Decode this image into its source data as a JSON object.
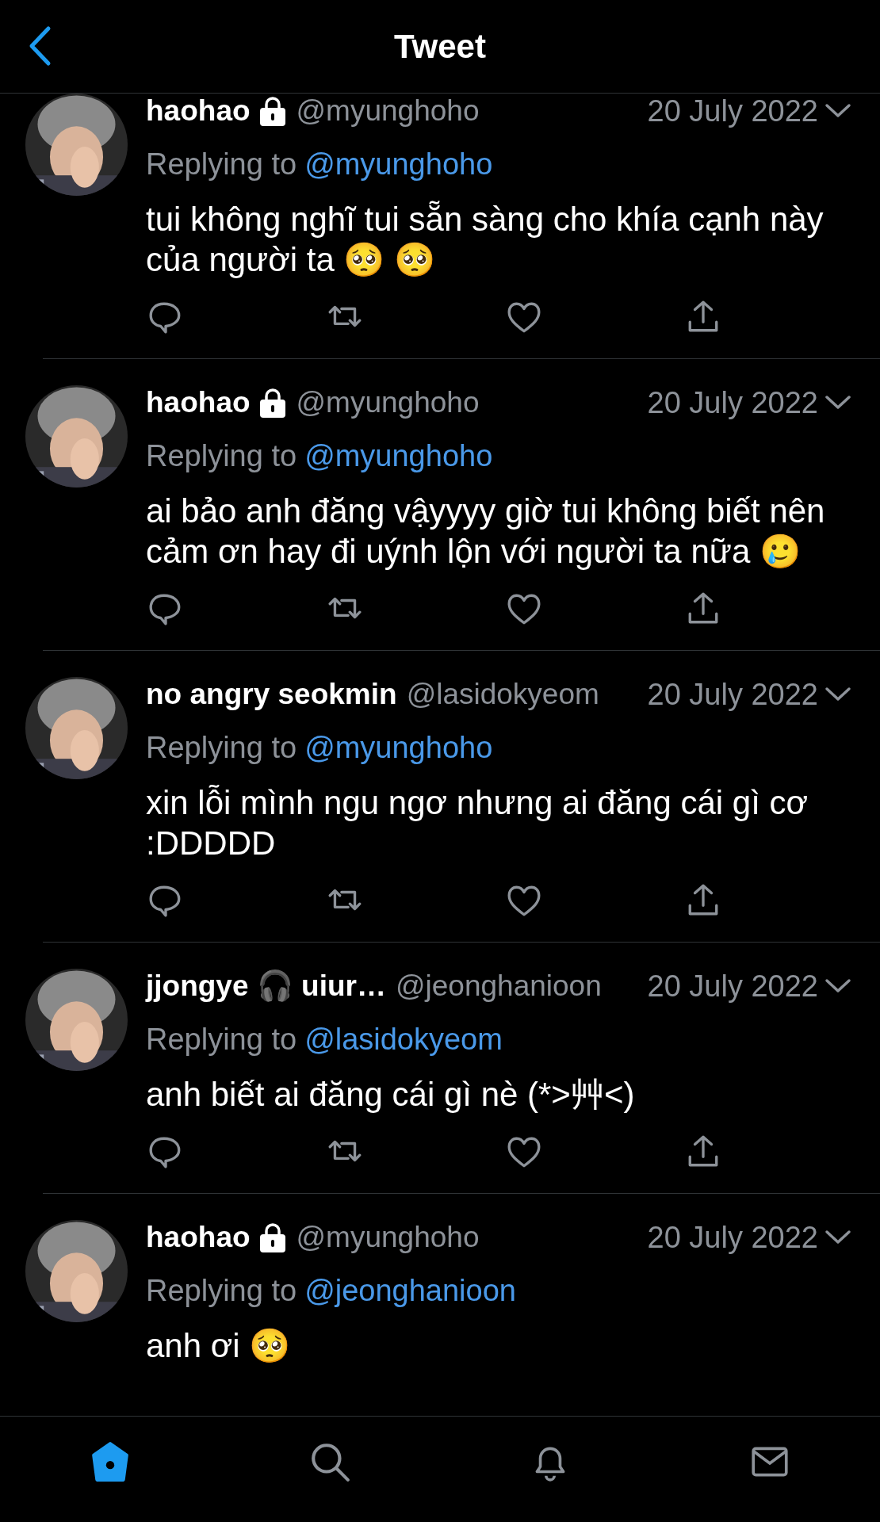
{
  "header": {
    "title": "Tweet"
  },
  "tweets": [
    {
      "name": "haohao",
      "locked": true,
      "handle": "@myunghoho",
      "date": "20 July 2022",
      "replying_label": "Replying to",
      "replying_to": "@myunghoho",
      "text": "tui không nghĩ tui sẵn sàng cho khía cạnh này của người ta 🥺 🥺"
    },
    {
      "name": "haohao",
      "locked": true,
      "handle": "@myunghoho",
      "date": "20 July 2022",
      "replying_label": "Replying to",
      "replying_to": "@myunghoho",
      "text": "ai bảo anh đăng vậyyyy giờ tui không biết nên cảm ơn hay đi uýnh lộn với người ta nữa 🥲"
    },
    {
      "name": "no angry seokmin",
      "locked": false,
      "handle": "@lasidokyeom",
      "date": "20 July 2022",
      "replying_label": "Replying to",
      "replying_to": "@myunghoho",
      "text": "xin lỗi mình ngu ngơ nhưng ai đăng cái gì cơ :DDDDD"
    },
    {
      "name": "jjongye 🎧 uiur…",
      "locked": false,
      "handle": "@jeonghanioon",
      "date": "20 July 2022",
      "replying_label": "Replying to",
      "replying_to": "@lasidokyeom",
      "text": "anh biết ai đăng cái gì nè (*>艸<)"
    },
    {
      "name": "haohao",
      "locked": true,
      "handle": "@myunghoho",
      "date": "20 July 2022",
      "replying_label": "Replying to",
      "replying_to": "@jeonghanioon",
      "text": "anh ơi 🥺",
      "partial": true
    }
  ],
  "tab_bar": [
    {
      "kind": "home",
      "selected": true
    },
    {
      "kind": "search",
      "selected": false
    },
    {
      "kind": "notifications",
      "selected": false
    },
    {
      "kind": "messages",
      "selected": false
    }
  ]
}
